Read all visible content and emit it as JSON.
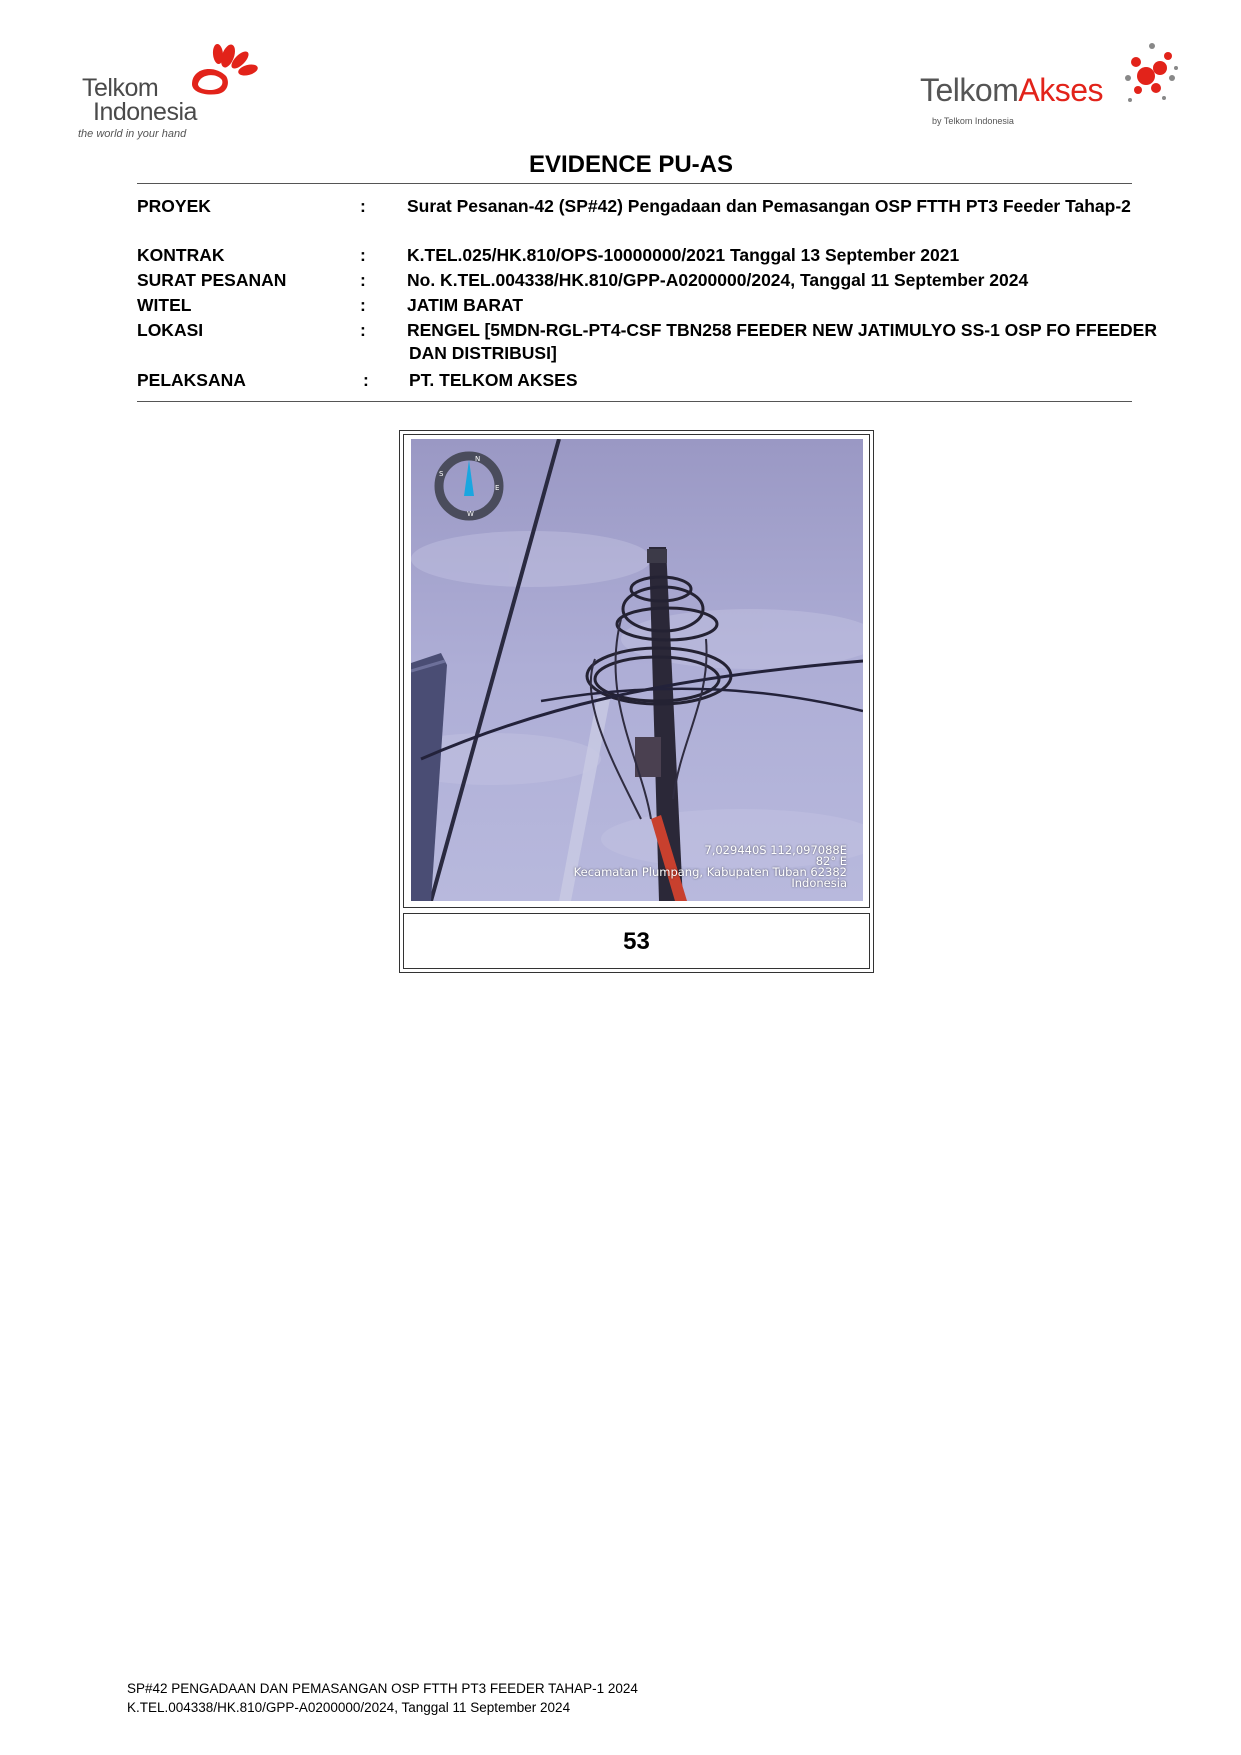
{
  "header": {
    "left_logo": {
      "line1": "Telkom",
      "line2": "Indonesia",
      "tagline": "the world in your hand"
    },
    "right_logo": {
      "word1": "Telkom",
      "word2": "Akses",
      "by": "by Telkom Indonesia"
    },
    "brand_red": "#e2231a"
  },
  "title": "EVIDENCE PU-AS",
  "info": {
    "colon": ":",
    "proyek": {
      "label": "PROYEK",
      "value": "Surat Pesanan-42 (SP#42) Pengadaan dan Pemasangan OSP FTTH PT3 Feeder Tahap-2"
    },
    "kontrak": {
      "label": "KONTRAK",
      "value": "K.TEL.025/HK.810/OPS-10000000/2021 Tanggal 13 September 2021"
    },
    "surat_pesanan": {
      "label": "SURAT PESANAN",
      "value": "No. K.TEL.004338/HK.810/GPP-A0200000/2024, Tanggal 11 September 2024"
    },
    "witel": {
      "label": "WITEL",
      "value": "JATIM BARAT"
    },
    "lokasi": {
      "label": "LOKASI",
      "value": "RENGEL [5MDN-RGL-PT4-CSF TBN258 FEEDER NEW JATIMULYO SS-1 OSP FO FFEEDER",
      "value_line2": "DAN DISTRIBUSI]"
    },
    "pelaksana": {
      "label": "PELAKSANA",
      "value": "PT. TELKOM AKSES"
    }
  },
  "evidence": {
    "number": "53",
    "stamp": {
      "coords": "7,029440S 112,097088E",
      "heading": "82° E",
      "address": "Kecamatan Plumpang, Kabupaten Tuban 62382",
      "country": "Indonesia"
    },
    "compass_letters": [
      "N",
      "E",
      "S",
      "W"
    ]
  },
  "footer": {
    "line1": "SP#42 PENGADAAN DAN PEMASANGAN OSP FTTH PT3 FEEDER TAHAP-1 2024",
    "line2": "K.TEL.004338/HK.810/GPP-A0200000/2024, Tanggal 11 September 2024"
  }
}
